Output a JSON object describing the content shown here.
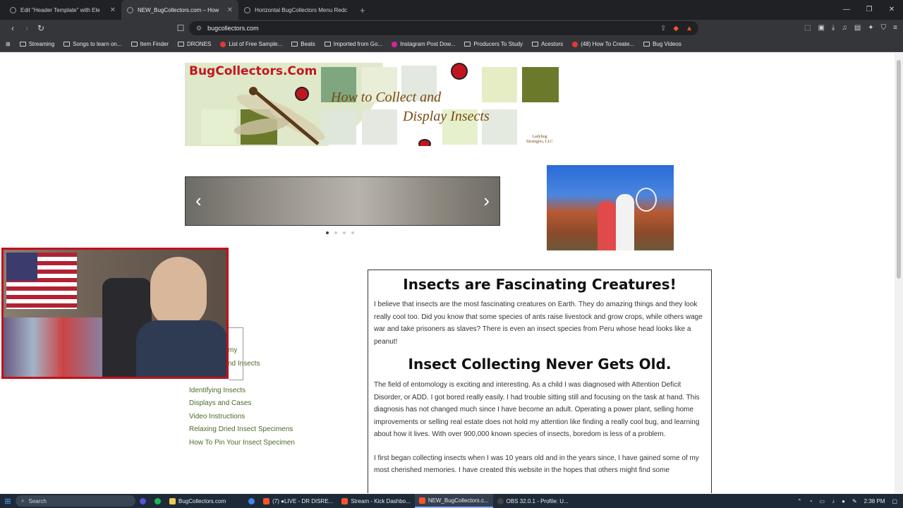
{
  "tabs": [
    {
      "title": "Edit \"Header Template\" with Ele",
      "active": false
    },
    {
      "title": "NEW_BugCollectors.com – How",
      "active": true
    },
    {
      "title": "Horizontal BugCollectors Menu Redc",
      "active": false
    }
  ],
  "address": "bugcollectors.com",
  "bookmarks": [
    "Streaming",
    "Songs to learn on...",
    "Item Finder",
    "DRONES",
    "List of Free Sample...",
    "Beats",
    "Imported from Go...",
    "Instagram Post Dow...",
    "Producers To Study",
    "Acestors",
    "(48) How To Create...",
    "Bug Videos"
  ],
  "banner": {
    "site_name": "BugCollectors.Com",
    "subtitle_line1": "How to Collect and",
    "subtitle_line2": "Display Insects",
    "company": "Ladybug Strategies, LLC"
  },
  "slider": {
    "prev_glyph": "‹",
    "next_glyph": "›",
    "slide_count": 4,
    "active_index": 0
  },
  "sidebar": {
    "partial_items": [
      "my",
      "nd Insects"
    ],
    "items": [
      "Identifying Insects",
      "Displays and Cases",
      "Video Instructions",
      "Relaxing Dried Insect Specimens",
      "How To Pin Your Insect Specimen"
    ]
  },
  "content": {
    "heading1": "Insects are Fascinating Creatures!",
    "para1": "I believe that insects are the most fascinating creatures on Earth. They do amazing things and they look really cool too. Did you know that some species of ants raise livestock and grow crops, while others wage war and take prisoners as slaves? There is even an insect species from Peru whose head looks like a peanut!",
    "heading2": "Insect Collecting Never Gets Old.",
    "para2": "The field of entomology is exciting and interesting. As a child I was diagnosed with Attention Deficit Disorder, or ADD. I got bored really easily. I had trouble sitting still and focusing on the task at hand. This diagnosis has not changed much since I have become an adult. Operating a power plant, selling home improvements or selling real estate does not hold my attention like finding a really cool bug, and learning about how it lives. With over 900,000 known species of insects, boredom is less of a problem.",
    "para3": "I first began collecting insects when I was 10 years old and in the years since, I have gained some of my most cherished memories. I have created this website in the hopes that others might find some"
  },
  "taskbar": {
    "search": "Search",
    "items": [
      "BugCollectors.com",
      "(7) ●LIVE - DR DISRE...",
      "Stream - Kick Dashbo...",
      "NEW_BugCollectors.c...",
      "OBS 32.0.1 - Profile: U..."
    ],
    "time": "2:38 PM"
  },
  "colors": {
    "accent_red": "#c0171f",
    "nav_green": "#4a6b2a",
    "banner_brown": "#7a4a10"
  }
}
